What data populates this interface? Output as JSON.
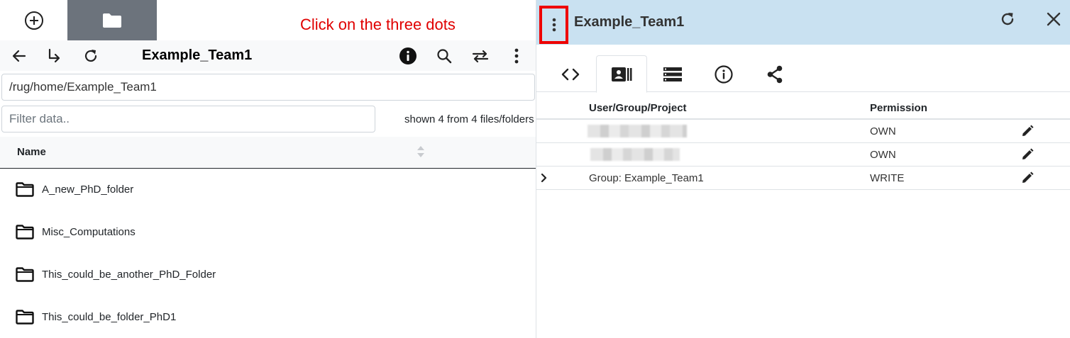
{
  "annotation": "Click on the three dots",
  "left_pane": {
    "toolbar": {
      "title": "Example_Team1"
    },
    "path_value": "/rug/home/Example_Team1",
    "filter_placeholder": "Filter data..",
    "shown_count": "shown 4 from 4 files/folders",
    "table_header": {
      "name": "Name"
    },
    "files": [
      {
        "name": "A_new_PhD_folder"
      },
      {
        "name": "Misc_Computations"
      },
      {
        "name": "This_could_be_another_PhD_Folder"
      },
      {
        "name": "This_could_be_folder_PhD1"
      }
    ]
  },
  "right_pane": {
    "title": "Example_Team1",
    "header_bg": "#c9e1f1",
    "highlight_color": "#ee0000",
    "tabs": [
      {
        "icon": "code-icon"
      },
      {
        "icon": "id-card-icon",
        "active": true
      },
      {
        "icon": "list-icon"
      },
      {
        "icon": "info-icon"
      },
      {
        "icon": "share-icon"
      }
    ],
    "acl": {
      "headers": {
        "user": "User/Group/Project",
        "permission": "Permission"
      },
      "rows": [
        {
          "user": "",
          "redacted": true,
          "permission": "OWN"
        },
        {
          "user": "",
          "redacted": true,
          "permission": "OWN"
        },
        {
          "user": "Group: Example_Team1",
          "redacted": false,
          "permission": "WRITE"
        }
      ]
    }
  }
}
